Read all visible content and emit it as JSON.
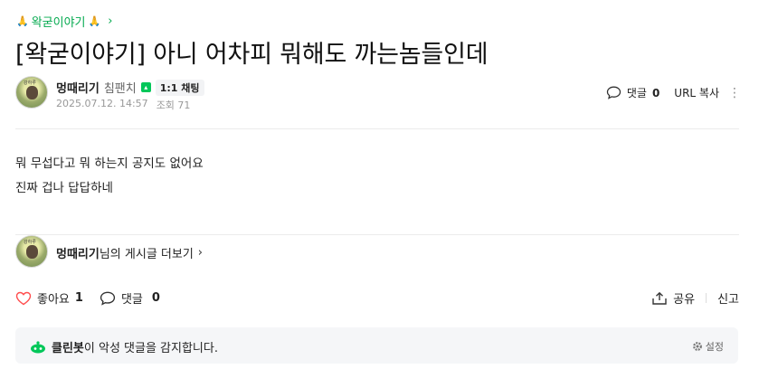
{
  "board": {
    "name": "왁굳이야기",
    "hand_icon": "🙏"
  },
  "post": {
    "title": "[왁굳이야기] 아니 어차피 뭐해도 까는놈들인데",
    "body_lines": [
      "뭐 무섭다고 뭐 하는지 공지도 없어요",
      "진짜 겁나 답답하네"
    ]
  },
  "author": {
    "name": "멍때리기",
    "level": "침팬치",
    "chat_badge": "1:1 채팅",
    "date": "2025.07.12. 14:57",
    "views_label": "조회 71",
    "avatar_tag": "강하루"
  },
  "header_actions": {
    "comment_label": "댓글",
    "comment_count": "0",
    "url_copy": "URL 복사"
  },
  "profile_link": {
    "name": "멍때리기",
    "suffix": "님의 게시글 더보기"
  },
  "footer_actions": {
    "like_label": "좋아요",
    "like_count": "1",
    "comment_label": "댓글",
    "comment_count": "0",
    "share_label": "공유",
    "report_label": "신고"
  },
  "cleanbot": {
    "name": "클린봇",
    "message": "이 악성 댓글을 감지합니다.",
    "settings_label": "설정"
  },
  "colors": {
    "accent_green": "#03c75a",
    "like_red": "#ff4e4e"
  }
}
